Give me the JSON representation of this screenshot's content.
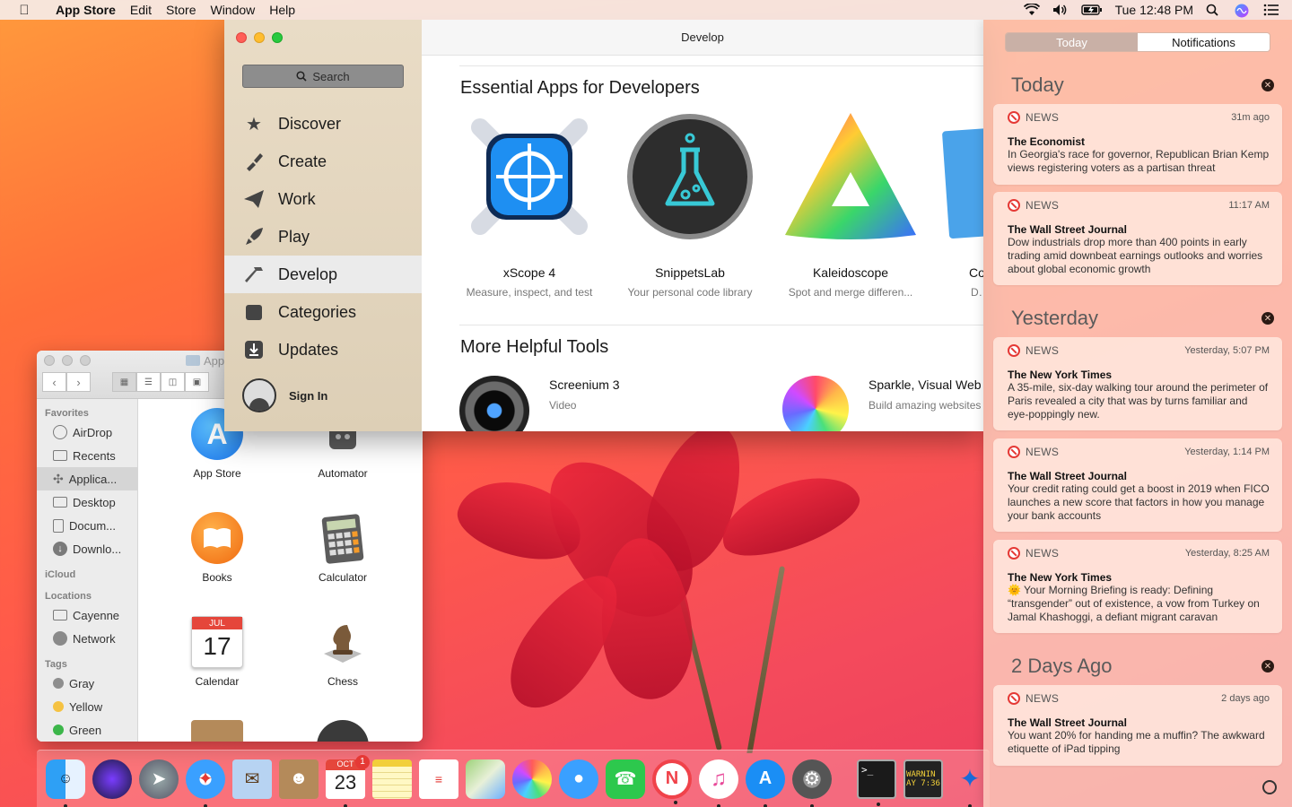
{
  "menubar": {
    "app_name": "App Store",
    "items": [
      "Edit",
      "Store",
      "Window",
      "Help"
    ],
    "clock": "Tue 12:48 PM"
  },
  "appstore": {
    "search_label": "Search",
    "nav": [
      {
        "label": "Discover",
        "icon": "star-icon"
      },
      {
        "label": "Create",
        "icon": "brush-icon"
      },
      {
        "label": "Work",
        "icon": "paper-plane-icon"
      },
      {
        "label": "Play",
        "icon": "rocket-icon"
      },
      {
        "label": "Develop",
        "icon": "hammer-icon",
        "active": true
      },
      {
        "label": "Categories",
        "icon": "stack-icon"
      },
      {
        "label": "Updates",
        "icon": "download-icon"
      }
    ],
    "sign_in": "Sign In",
    "window_title": "Develop",
    "section1_title": "Essential Apps for Developers",
    "apps": [
      {
        "name": "xScope 4",
        "desc": "Measure, inspect, and test"
      },
      {
        "name": "SnippetsLab",
        "desc": "Your personal code library"
      },
      {
        "name": "Kaleidoscope",
        "desc": "Spot and merge differen..."
      },
      {
        "name": "Co",
        "desc": "De"
      }
    ],
    "section2_title": "More Helpful Tools",
    "tools": [
      {
        "name": "Screenium 3",
        "desc": "Video"
      },
      {
        "name": "Sparkle, Visual Web",
        "desc": "Build amazing websites"
      }
    ]
  },
  "finder": {
    "title": "App",
    "favorites_label": "Favorites",
    "favorites": [
      "AirDrop",
      "Recents",
      "Applica...",
      "Desktop",
      "Docum...",
      "Downlo..."
    ],
    "icloud_label": "iCloud",
    "locations_label": "Locations",
    "locations": [
      "Cayenne",
      "Network"
    ],
    "tags_label": "Tags",
    "tags": [
      {
        "name": "Gray",
        "color": "#8e8e8e"
      },
      {
        "name": "Yellow",
        "color": "#f5c242"
      },
      {
        "name": "Green",
        "color": "#3cb64a"
      }
    ],
    "apps": [
      "App Store",
      "Automator",
      "Books",
      "Calculator",
      "Calendar",
      "Chess"
    ],
    "calendar_month": "JUL",
    "calendar_day": "17"
  },
  "notification_center": {
    "tab_today": "Today",
    "tab_notifications": "Notifications",
    "groups": [
      {
        "day": "Today",
        "items": [
          {
            "app": "NEWS",
            "time": "31m ago",
            "source": "The Economist",
            "body": "In Georgia's race for governor, Republican Brian Kemp views registering voters as a partisan threat"
          },
          {
            "app": "NEWS",
            "time": "11:17 AM",
            "source": "The Wall Street Journal",
            "body": "Dow industrials drop more than 400 points in early trading amid downbeat earnings outlooks and worries about global economic growth"
          }
        ]
      },
      {
        "day": "Yesterday",
        "items": [
          {
            "app": "NEWS",
            "time": "Yesterday, 5:07 PM",
            "source": "The New York Times",
            "body": "A 35-mile, six-day walking tour around the perimeter of Paris revealed a city that was by turns familiar and eye-poppingly new."
          },
          {
            "app": "NEWS",
            "time": "Yesterday, 1:14 PM",
            "source": "The Wall Street Journal",
            "body": "Your credit rating could get a boost in 2019 when FICO launches a new score that factors in how you manage your bank accounts"
          },
          {
            "app": "NEWS",
            "time": "Yesterday, 8:25 AM",
            "source": "The New York Times",
            "body": "🌞 Your Morning Briefing is ready: Defining “transgender” out of existence, a vow from Turkey on Jamal Khashoggi, a defiant migrant caravan"
          }
        ]
      },
      {
        "day": "2 Days Ago",
        "items": [
          {
            "app": "NEWS",
            "time": "2 days ago",
            "source": "The Wall Street Journal",
            "body": "You want 20% for handing me a muffin? The awkward etiquette of iPad tipping"
          }
        ]
      }
    ]
  },
  "dock": {
    "calendar_month": "OCT",
    "calendar_day": "23",
    "calendar_badge": "1",
    "console_text": "WARNIN\nAY 7:36"
  }
}
